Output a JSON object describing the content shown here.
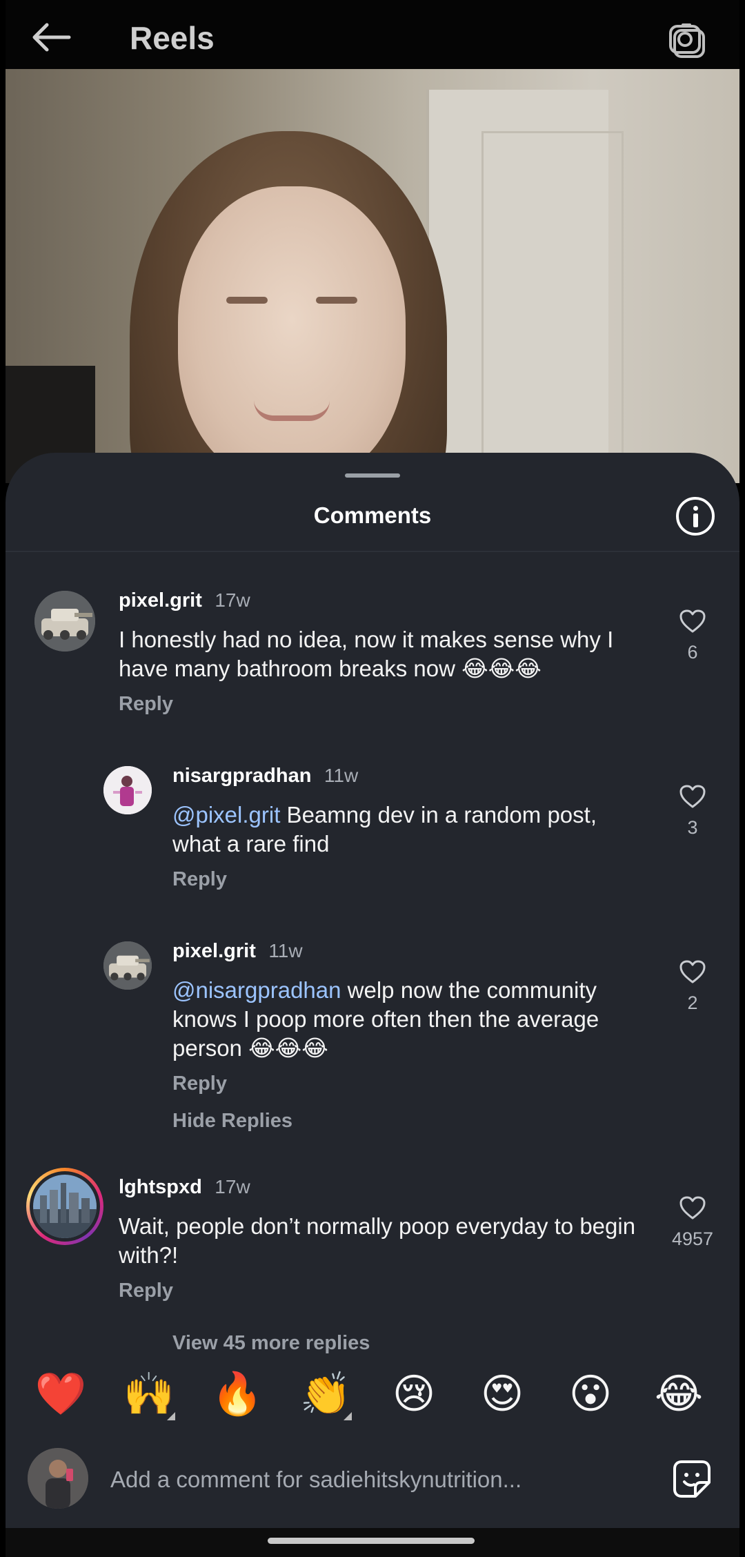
{
  "header": {
    "title": "Reels"
  },
  "sheet": {
    "title": "Comments"
  },
  "comments": [
    {
      "username": "pixel.grit",
      "time": "17w",
      "text": "I honestly had no idea, now it makes sense why I have many bathroom breaks now 😂😂😂",
      "reply_label": "Reply",
      "likes": "6"
    },
    {
      "username": "nisargpradhan",
      "time": "11w",
      "mention": "@pixel.grit",
      "text": " Beamng dev in a random post, what a rare find",
      "reply_label": "Reply",
      "likes": "3"
    },
    {
      "username": "pixel.grit",
      "time": "11w",
      "mention": "@nisargpradhan",
      "text": " welp now the community knows I poop more often then the average person 😂😂😂",
      "reply_label": "Reply",
      "likes": "2"
    },
    {
      "username": "lghtspxd",
      "time": "17w",
      "text": "Wait, people don’t normally poop everyday to begin with?!",
      "reply_label": "Reply",
      "likes": "4957"
    }
  ],
  "hide_replies_label": "Hide Replies",
  "view_more_label": "View 45 more replies",
  "quick_emojis": [
    "❤️",
    "🙌",
    "🔥",
    "👏",
    "😢",
    "😍",
    "😮",
    "😂"
  ],
  "composer": {
    "placeholder": "Add a comment for sadiehitskynutrition..."
  },
  "colors": {
    "sheet_bg": "#23262d",
    "mention": "#9cc4ff",
    "muted": "#9ba0a8"
  }
}
